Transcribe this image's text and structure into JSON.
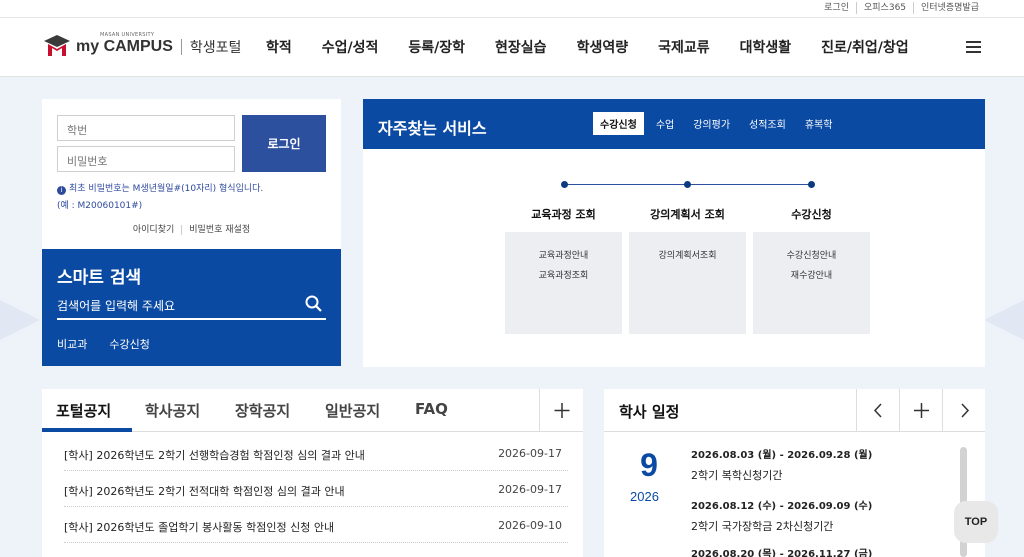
{
  "top_links": [
    "로그인",
    "오피스365",
    "인터넷증명발급"
  ],
  "logo": {
    "sub": "MASAN UNIVERSITY",
    "main": "my CAMPUS",
    "portal": "학생포털"
  },
  "gnb": [
    "학적",
    "수업/성적",
    "등록/장학",
    "현장실습",
    "학생역량",
    "국제교류",
    "대학생활",
    "진로/취업/창업"
  ],
  "login": {
    "id_placeholder": "학번",
    "pw_placeholder": "비밀번호",
    "button": "로그인",
    "notice_line1": "최초 비밀번호는 M생년월일#(10자리) 형식입니다.",
    "notice_line2": "(예 : M20060101#)",
    "find_id": "아이디찾기",
    "reset_pw": "비밀번호 재설정"
  },
  "smart_search": {
    "title": "스마트 검색",
    "placeholder": "검색어를 입력해 주세요",
    "tags": [
      "비교과",
      "수강신청"
    ]
  },
  "services": {
    "title": "자주찾는 서비스",
    "tabs": [
      "수강신청",
      "수업",
      "강의평가",
      "성적조회",
      "휴복학"
    ],
    "columns": [
      {
        "title": "교육과정 조회",
        "items": [
          "교육과정안내",
          "교육과정조회"
        ]
      },
      {
        "title": "강의계획서 조회",
        "items": [
          "강의계획서조회"
        ]
      },
      {
        "title": "수강신청",
        "items": [
          "수강신청안내",
          "재수강안내"
        ]
      }
    ]
  },
  "notices": {
    "tabs": [
      "포털공지",
      "학사공지",
      "장학공지",
      "일반공지",
      "FAQ"
    ],
    "rows": [
      {
        "title": "[학사] 2026학년도 2학기 선행학습경험 학점인정 심의 결과 안내",
        "date": "2026-09-17"
      },
      {
        "title": "[학사] 2026학년도 2학기 전적대학 학점인정 심의 결과 안내",
        "date": "2026-09-17"
      },
      {
        "title": "[학사] 2026학년도 졸업학기 봉사활동 학점인정 신청 안내",
        "date": "2026-09-10"
      }
    ]
  },
  "schedule": {
    "title": "학사 일정",
    "month": "9",
    "year": "2026",
    "events": [
      {
        "date": "2026.08.03 (월) - 2026.09.28 (월)",
        "name": "2학기 복학신청기간"
      },
      {
        "date": "2026.08.12 (수) - 2026.09.09 (수)",
        "name": "2학기 국가장학금 2차신청기간"
      },
      {
        "date": "2026.08.20 (목) - 2026.11.27 (금)",
        "name": ""
      }
    ]
  },
  "top_button": "TOP",
  "colors": {
    "primary": "#0b4aa3",
    "button": "#2c4f9e",
    "background": "#eef2f9"
  }
}
